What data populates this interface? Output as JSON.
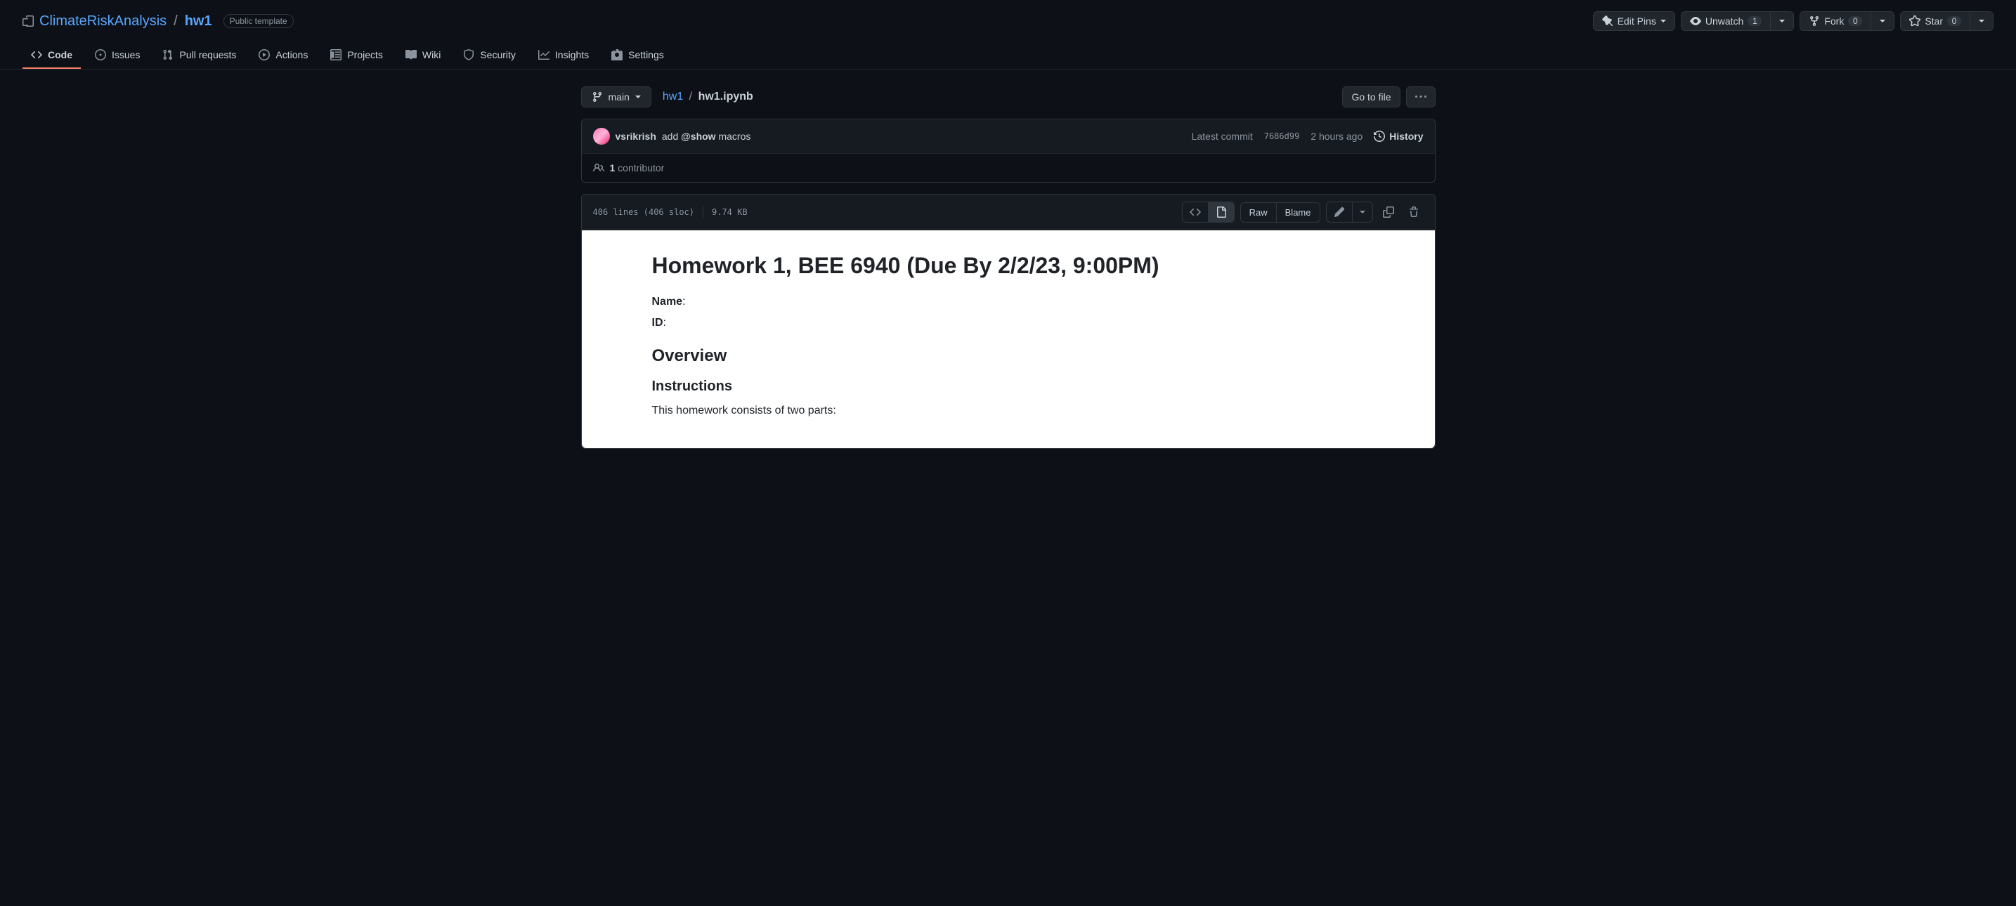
{
  "header": {
    "org": "ClimateRiskAnalysis",
    "repo": "hw1",
    "label": "Public template",
    "editPins": "Edit Pins",
    "unwatch": "Unwatch",
    "unwatchCount": "1",
    "fork": "Fork",
    "forkCount": "0",
    "star": "Star",
    "starCount": "0"
  },
  "tabs": {
    "code": "Code",
    "issues": "Issues",
    "pulls": "Pull requests",
    "actions": "Actions",
    "projects": "Projects",
    "wiki": "Wiki",
    "security": "Security",
    "insights": "Insights",
    "settings": "Settings"
  },
  "fileNav": {
    "branch": "main",
    "pathRepo": "hw1",
    "pathFile": "hw1.ipynb",
    "goToFile": "Go to file"
  },
  "commit": {
    "author": "vsrikrish",
    "msgPrefix": "add ",
    "msgBold": "@show",
    "msgSuffix": " macros",
    "latestLabel": "Latest commit",
    "hash": "7686d99",
    "time": "2 hours ago",
    "history": "History",
    "contribCount": "1",
    "contribLabel": " contributor"
  },
  "fileHeader": {
    "lines": "406 lines (406 sloc)",
    "size": "9.74 KB",
    "raw": "Raw",
    "blame": "Blame"
  },
  "content": {
    "h1": "Homework 1, BEE 6940 (Due By 2/2/23, 9:00PM)",
    "nameLabel": "Name",
    "idLabel": "ID",
    "overview": "Overview",
    "instructions": "Instructions",
    "body1": "This homework consists of two parts:"
  }
}
